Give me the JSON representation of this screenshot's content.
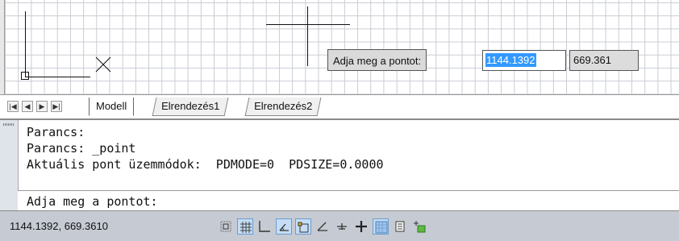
{
  "drawing": {
    "tooltip_label": "Adja meg a pontot:",
    "input_x": "1144.1392",
    "input_y": "669.361"
  },
  "layout_tabs": {
    "nav": [
      "first-tab-icon",
      "prev-tab-icon",
      "next-tab-icon",
      "last-tab-icon"
    ],
    "tabs": [
      {
        "label": "Modell",
        "active": true
      },
      {
        "label": "Elrendezés1",
        "active": false
      },
      {
        "label": "Elrendezés2",
        "active": false
      }
    ]
  },
  "command_window": {
    "history": [
      "Parancs:",
      "Parancs: _point",
      "Aktuális pont üzemmódok:  PDMODE=0  PDSIZE=0.0000"
    ],
    "prompt": "Adja meg a pontot:"
  },
  "status_bar": {
    "coordinates": "1144.1392, 669.3610",
    "toggles": [
      {
        "name": "infer-constraints",
        "on": false
      },
      {
        "name": "snap",
        "on": true
      },
      {
        "name": "grid",
        "on": false
      },
      {
        "name": "ortho",
        "on": true
      },
      {
        "name": "polar",
        "on": true
      },
      {
        "name": "object-snap",
        "on": false
      },
      {
        "name": "3d-object-snap",
        "on": false
      },
      {
        "name": "object-snap-tracking",
        "on": false
      },
      {
        "name": "dynamic-ucs",
        "on": true
      },
      {
        "name": "dynamic-input",
        "on": false
      },
      {
        "name": "lineweight",
        "on": false
      }
    ]
  }
}
